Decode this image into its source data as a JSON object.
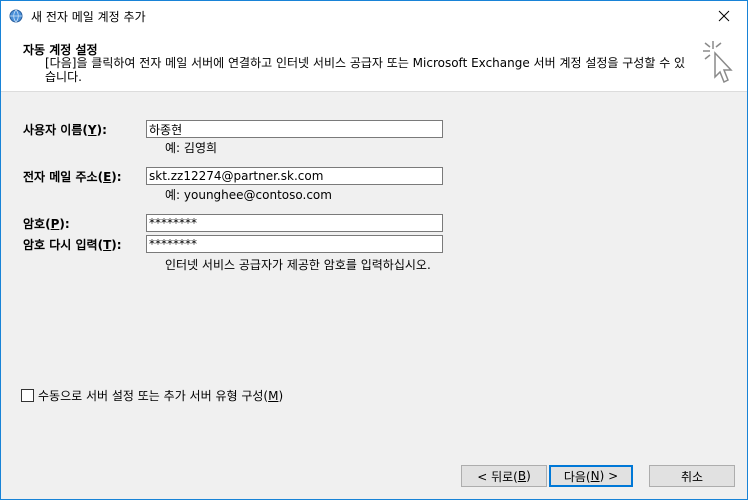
{
  "window": {
    "title": "새 전자 메일 계정 추가",
    "icons": {
      "app": "globe-mail-icon",
      "close": "close-icon"
    }
  },
  "header": {
    "title": "자동 계정 설정",
    "description": "[다음]을 클릭하여 전자 메일 서버에 연결하고 인터넷 서비스 공급자 또는 Microsoft Exchange 서버 계정 설정을 구성할 수 있습니다.",
    "icon": "sparkle-cursor-icon"
  },
  "form": {
    "name_label_pre": "사용자 이름(",
    "name_label_key": "Y",
    "name_label_post": "):",
    "name_value": "하종현",
    "name_hint": "예: 김영희",
    "email_label_pre": "전자 메일 주소(",
    "email_label_key": "E",
    "email_label_post": "):",
    "email_value": "skt.zz12274@partner.sk.com",
    "email_hint": "예: younghee@contoso.com",
    "password_label_pre": "암호(",
    "password_label_key": "P",
    "password_label_post": "):",
    "password_value": "********",
    "retype_label_pre": "암호 다시 입력(",
    "retype_label_key": "T",
    "retype_label_post": "):",
    "retype_value": "********",
    "password_hint": "인터넷 서비스 공급자가 제공한 암호를 입력하십시오."
  },
  "manual": {
    "label_pre": "수동으로 서버 설정 또는 추가 서버 유형 구성(",
    "label_key": "M",
    "label_post": ")",
    "checked": false
  },
  "buttons": {
    "back_pre": "< 뒤로(",
    "back_key": "B",
    "back_post": ")",
    "next_pre": "다음(",
    "next_key": "N",
    "next_post": ") >",
    "cancel": "취소"
  },
  "colors": {
    "border": "#1883d7",
    "accent": "#0078d7"
  }
}
